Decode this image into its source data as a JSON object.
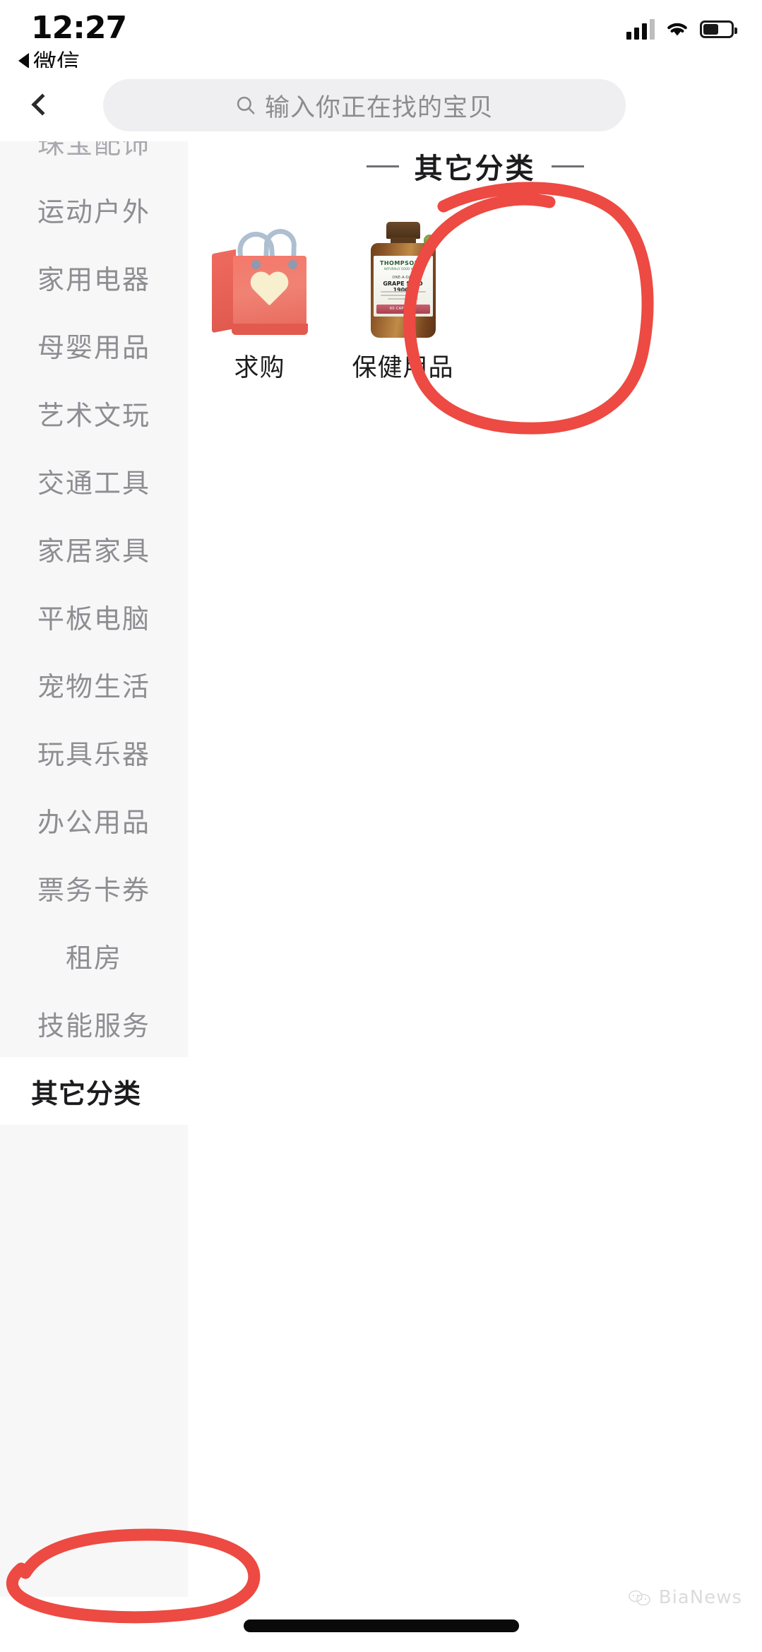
{
  "status_bar": {
    "time": "12:27",
    "return_app_label": "微信",
    "icons": [
      "signal-icon",
      "wifi-icon",
      "battery-icon"
    ]
  },
  "nav": {
    "back_icon": "chevron-left-icon"
  },
  "search": {
    "icon": "search-icon",
    "placeholder": "输入你正在找的宝贝",
    "value": ""
  },
  "sidebar": {
    "items": [
      {
        "label": "珠宝配饰",
        "selected": false,
        "clipped": true
      },
      {
        "label": "运动户外",
        "selected": false
      },
      {
        "label": "家用电器",
        "selected": false
      },
      {
        "label": "母婴用品",
        "selected": false
      },
      {
        "label": "艺术文玩",
        "selected": false
      },
      {
        "label": "交通工具",
        "selected": false
      },
      {
        "label": "家居家具",
        "selected": false
      },
      {
        "label": "平板电脑",
        "selected": false
      },
      {
        "label": "宠物生活",
        "selected": false
      },
      {
        "label": "玩具乐器",
        "selected": false
      },
      {
        "label": "办公用品",
        "selected": false
      },
      {
        "label": "票务卡券",
        "selected": false
      },
      {
        "label": "租房",
        "selected": false
      },
      {
        "label": "技能服务",
        "selected": false
      },
      {
        "label": "其它分类",
        "selected": true
      }
    ]
  },
  "main": {
    "section_title": "其它分类",
    "items": [
      {
        "label": "求购",
        "image": "shopping-bag-with-heart"
      },
      {
        "label": "保健用品",
        "image": "supplement-bottle"
      }
    ]
  },
  "product_label": {
    "brand": "THOMPSON'S",
    "brand_sub": "NATURALLY GOOD HEALTH",
    "small": "ONE-A-DAY",
    "main": "GRAPE SEED 19000",
    "band": "60 CAPSULES"
  },
  "annotations": {
    "color": "#ec4a42",
    "marks": [
      "circle-around-baojian-yongpin",
      "circle-around-qita-fenlei"
    ]
  },
  "watermark": {
    "text": "BiaNews",
    "icon": "chat-bubbles-icon"
  },
  "home_indicator": {
    "name": "home-indicator"
  }
}
